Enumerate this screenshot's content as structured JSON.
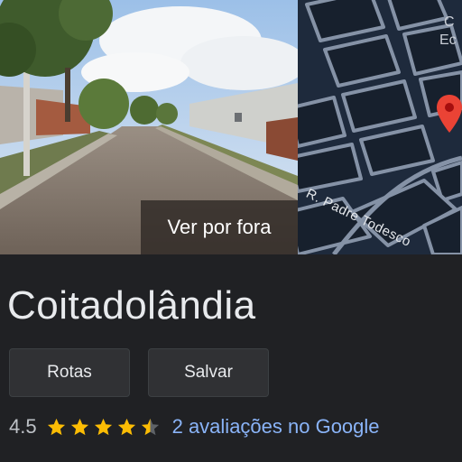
{
  "media": {
    "photo_overlay_label": "Ver por fora",
    "map_labels": {
      "top_line1": "C",
      "top_line2": "Ec",
      "street": "R. Padre Todesco"
    },
    "pin_color": "#ea4335"
  },
  "place": {
    "title": "Coitadolândia"
  },
  "actions": {
    "directions_label": "Rotas",
    "save_label": "Salvar"
  },
  "rating": {
    "value": "4.5",
    "stars_filled": 4.5,
    "stars_total": 5,
    "reviews_text": "2 avaliações no Google",
    "star_color": "#fbbc04"
  }
}
